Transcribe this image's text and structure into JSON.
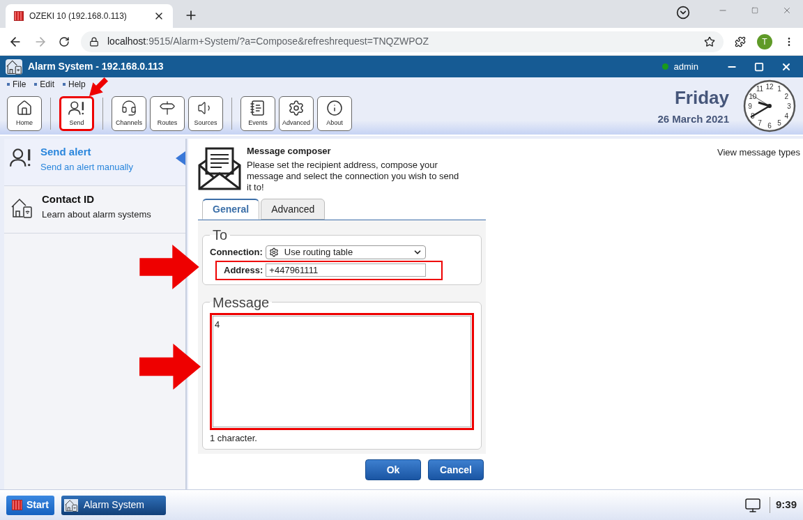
{
  "browser": {
    "tab_title": "OZEKI 10 (192.168.0.113)",
    "url_host": "localhost",
    "url_rest": ":9515/Alarm+System/?a=Compose&refreshrequest=TNQZWPOZ",
    "profile": "T"
  },
  "app": {
    "title": "Alarm System - 192.168.0.113",
    "user": "admin",
    "online": true
  },
  "menu": [
    "File",
    "Edit",
    "Help"
  ],
  "toolbar": [
    [
      {
        "label": "Home",
        "highlighted": false
      }
    ],
    [
      {
        "label": "Send",
        "highlighted": true
      }
    ],
    [
      {
        "label": "Channels",
        "highlighted": false
      },
      {
        "label": "Routes",
        "highlighted": false
      },
      {
        "label": "Sources",
        "highlighted": false
      }
    ],
    [
      {
        "label": "Events",
        "highlighted": false
      },
      {
        "label": "Advanced",
        "highlighted": false
      },
      {
        "label": "About",
        "highlighted": false
      }
    ]
  ],
  "date": {
    "day": "Friday",
    "date": "26 March 2021"
  },
  "clock": {
    "numbers": [
      "11",
      "12",
      "1",
      "10",
      "2",
      "9",
      "3",
      "8",
      "4",
      "7",
      "6",
      "5"
    ]
  },
  "sidebar": {
    "items": [
      {
        "title": "Send alert",
        "subtitle": "Send an alert manually",
        "selected": true
      },
      {
        "title": "Contact ID",
        "subtitle": "Learn about alarm systems",
        "selected": false
      }
    ]
  },
  "composer": {
    "title": "Message composer",
    "description": "Please set the recipient address, compose your message and select the connection you wish to send it to!",
    "link": "View message types",
    "tabs": [
      {
        "label": "General",
        "selected": true
      },
      {
        "label": "Advanced",
        "selected": false
      }
    ],
    "to_legend": "To",
    "connection_label": "Connection:",
    "connection_value": "Use routing table",
    "address_label": "Address:",
    "address_value": "+447961111",
    "address_highlighted": true,
    "message_legend": "Message",
    "message_value": "4",
    "message_highlighted": true,
    "char_count": "1 character.",
    "buttons": [
      {
        "label": "Ok"
      },
      {
        "label": "Cancel"
      }
    ]
  },
  "taskbar": {
    "start": "Start",
    "task": "Alarm System",
    "time": "9:39"
  }
}
